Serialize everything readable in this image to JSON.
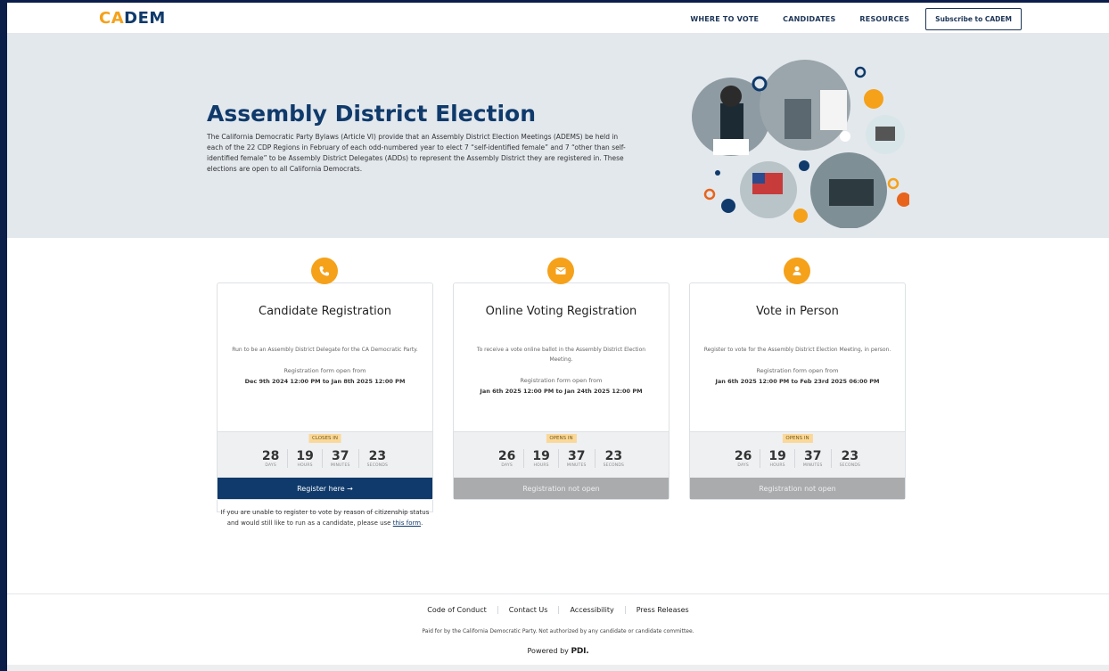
{
  "logo": {
    "part1": "CA",
    "part2": "DEM"
  },
  "nav": {
    "links": [
      "WHERE TO VOTE",
      "CANDIDATES",
      "RESOURCES"
    ],
    "subscribe": "Subscribe to CADEM"
  },
  "hero": {
    "title": "Assembly District Election",
    "text": "The California Democratic Party Bylaws (Article VI) provide that an Assembly District Election Meetings (ADEMS) be held in each of the 22 CDP Regions in February of each odd-numbered year to elect 7 “self-identified female” and 7 “other than self-identified female” to be Assembly District Delegates (ADDs) to represent the Assembly District they are registered in. These elections are open to all California Democrats."
  },
  "cards": [
    {
      "icon": "phone-icon",
      "title": "Candidate Registration",
      "desc": "Run to be an Assembly District Delegate for the CA Democratic Party.",
      "open_label": "Registration form open from",
      "range": "Dec 9th 2024 12:00 PM to Jan 8th 2025 12:00 PM",
      "badge": "CLOSES IN",
      "days": "28",
      "hours": "19",
      "minutes": "37",
      "seconds": "23",
      "days_label": "DAYS",
      "hours_label": "HOURS",
      "minutes_label": "MINUTES",
      "seconds_label": "SECONDS",
      "button": "Register here →",
      "note": "If you are unable to register to vote by reason of citizenship status and would still like to run as a candidate, please use",
      "note_link": "this form",
      "note_end": "."
    },
    {
      "icon": "envelope-icon",
      "title": "Online Voting Registration",
      "desc": "To receive a vote online ballot in the Assembly District Election Meeting.",
      "open_label": "Registration form open from",
      "range": "Jan 6th 2025 12:00 PM to Jan 24th 2025 12:00 PM",
      "badge": "OPENS IN",
      "days": "26",
      "hours": "19",
      "minutes": "37",
      "seconds": "23",
      "days_label": "DAYS",
      "hours_label": "HOURS",
      "minutes_label": "MINUTES",
      "seconds_label": "SECONDS",
      "button": "Registration not open"
    },
    {
      "icon": "person-icon",
      "title": "Vote in Person",
      "desc": "Register to vote for the Assembly District Election Meeting, in person.",
      "open_label": "Registration form open from",
      "range": "Jan 6th 2025 12:00 PM to Feb 23rd 2025 06:00 PM",
      "badge": "OPENS IN",
      "days": "26",
      "hours": "19",
      "minutes": "37",
      "seconds": "23",
      "days_label": "DAYS",
      "hours_label": "HOURS",
      "minutes_label": "MINUTES",
      "seconds_label": "SECONDS",
      "button": "Registration not open"
    }
  ],
  "footer": {
    "links": [
      "Code of Conduct",
      "Contact Us",
      "Accessibility",
      "Press Releases"
    ],
    "paid": "Paid for by the California Democratic Party. Not authorized by any candidate or candidate committee.",
    "powered": "Powered by",
    "powered_brand": "PDI."
  },
  "colors": {
    "brand_orange": "#f5a11a",
    "brand_navy": "#0f3a6b",
    "hero_bg": "#e3e8ed",
    "disabled": "#a9abad"
  }
}
